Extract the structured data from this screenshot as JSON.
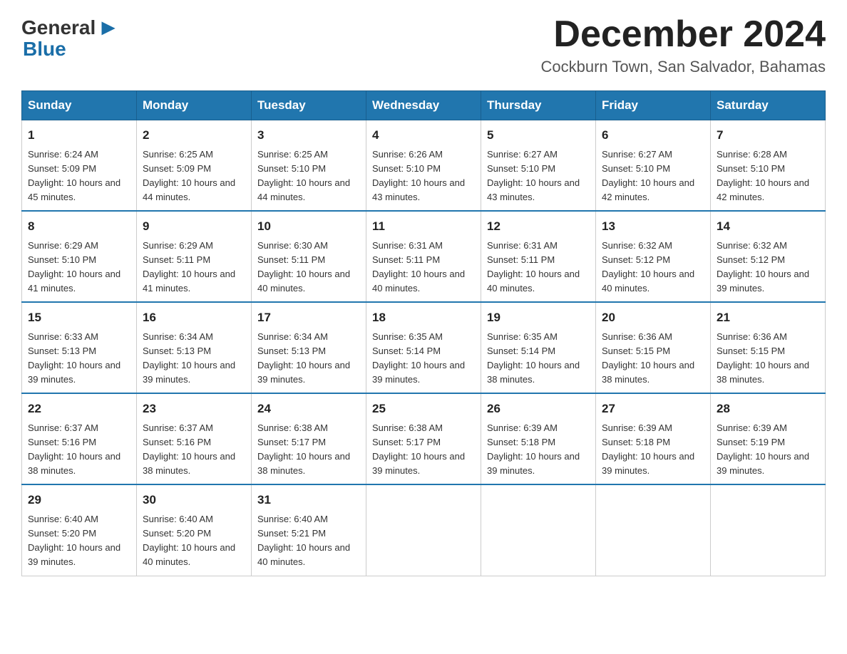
{
  "logo": {
    "general": "General",
    "blue": "Blue"
  },
  "title": "December 2024",
  "location": "Cockburn Town, San Salvador, Bahamas",
  "days_of_week": [
    "Sunday",
    "Monday",
    "Tuesday",
    "Wednesday",
    "Thursday",
    "Friday",
    "Saturday"
  ],
  "weeks": [
    [
      {
        "day": "1",
        "sunrise": "6:24 AM",
        "sunset": "5:09 PM",
        "daylight": "10 hours and 45 minutes."
      },
      {
        "day": "2",
        "sunrise": "6:25 AM",
        "sunset": "5:09 PM",
        "daylight": "10 hours and 44 minutes."
      },
      {
        "day": "3",
        "sunrise": "6:25 AM",
        "sunset": "5:10 PM",
        "daylight": "10 hours and 44 minutes."
      },
      {
        "day": "4",
        "sunrise": "6:26 AM",
        "sunset": "5:10 PM",
        "daylight": "10 hours and 43 minutes."
      },
      {
        "day": "5",
        "sunrise": "6:27 AM",
        "sunset": "5:10 PM",
        "daylight": "10 hours and 43 minutes."
      },
      {
        "day": "6",
        "sunrise": "6:27 AM",
        "sunset": "5:10 PM",
        "daylight": "10 hours and 42 minutes."
      },
      {
        "day": "7",
        "sunrise": "6:28 AM",
        "sunset": "5:10 PM",
        "daylight": "10 hours and 42 minutes."
      }
    ],
    [
      {
        "day": "8",
        "sunrise": "6:29 AM",
        "sunset": "5:10 PM",
        "daylight": "10 hours and 41 minutes."
      },
      {
        "day": "9",
        "sunrise": "6:29 AM",
        "sunset": "5:11 PM",
        "daylight": "10 hours and 41 minutes."
      },
      {
        "day": "10",
        "sunrise": "6:30 AM",
        "sunset": "5:11 PM",
        "daylight": "10 hours and 40 minutes."
      },
      {
        "day": "11",
        "sunrise": "6:31 AM",
        "sunset": "5:11 PM",
        "daylight": "10 hours and 40 minutes."
      },
      {
        "day": "12",
        "sunrise": "6:31 AM",
        "sunset": "5:11 PM",
        "daylight": "10 hours and 40 minutes."
      },
      {
        "day": "13",
        "sunrise": "6:32 AM",
        "sunset": "5:12 PM",
        "daylight": "10 hours and 40 minutes."
      },
      {
        "day": "14",
        "sunrise": "6:32 AM",
        "sunset": "5:12 PM",
        "daylight": "10 hours and 39 minutes."
      }
    ],
    [
      {
        "day": "15",
        "sunrise": "6:33 AM",
        "sunset": "5:13 PM",
        "daylight": "10 hours and 39 minutes."
      },
      {
        "day": "16",
        "sunrise": "6:34 AM",
        "sunset": "5:13 PM",
        "daylight": "10 hours and 39 minutes."
      },
      {
        "day": "17",
        "sunrise": "6:34 AM",
        "sunset": "5:13 PM",
        "daylight": "10 hours and 39 minutes."
      },
      {
        "day": "18",
        "sunrise": "6:35 AM",
        "sunset": "5:14 PM",
        "daylight": "10 hours and 39 minutes."
      },
      {
        "day": "19",
        "sunrise": "6:35 AM",
        "sunset": "5:14 PM",
        "daylight": "10 hours and 38 minutes."
      },
      {
        "day": "20",
        "sunrise": "6:36 AM",
        "sunset": "5:15 PM",
        "daylight": "10 hours and 38 minutes."
      },
      {
        "day": "21",
        "sunrise": "6:36 AM",
        "sunset": "5:15 PM",
        "daylight": "10 hours and 38 minutes."
      }
    ],
    [
      {
        "day": "22",
        "sunrise": "6:37 AM",
        "sunset": "5:16 PM",
        "daylight": "10 hours and 38 minutes."
      },
      {
        "day": "23",
        "sunrise": "6:37 AM",
        "sunset": "5:16 PM",
        "daylight": "10 hours and 38 minutes."
      },
      {
        "day": "24",
        "sunrise": "6:38 AM",
        "sunset": "5:17 PM",
        "daylight": "10 hours and 38 minutes."
      },
      {
        "day": "25",
        "sunrise": "6:38 AM",
        "sunset": "5:17 PM",
        "daylight": "10 hours and 39 minutes."
      },
      {
        "day": "26",
        "sunrise": "6:39 AM",
        "sunset": "5:18 PM",
        "daylight": "10 hours and 39 minutes."
      },
      {
        "day": "27",
        "sunrise": "6:39 AM",
        "sunset": "5:18 PM",
        "daylight": "10 hours and 39 minutes."
      },
      {
        "day": "28",
        "sunrise": "6:39 AM",
        "sunset": "5:19 PM",
        "daylight": "10 hours and 39 minutes."
      }
    ],
    [
      {
        "day": "29",
        "sunrise": "6:40 AM",
        "sunset": "5:20 PM",
        "daylight": "10 hours and 39 minutes."
      },
      {
        "day": "30",
        "sunrise": "6:40 AM",
        "sunset": "5:20 PM",
        "daylight": "10 hours and 40 minutes."
      },
      {
        "day": "31",
        "sunrise": "6:40 AM",
        "sunset": "5:21 PM",
        "daylight": "10 hours and 40 minutes."
      },
      null,
      null,
      null,
      null
    ]
  ]
}
